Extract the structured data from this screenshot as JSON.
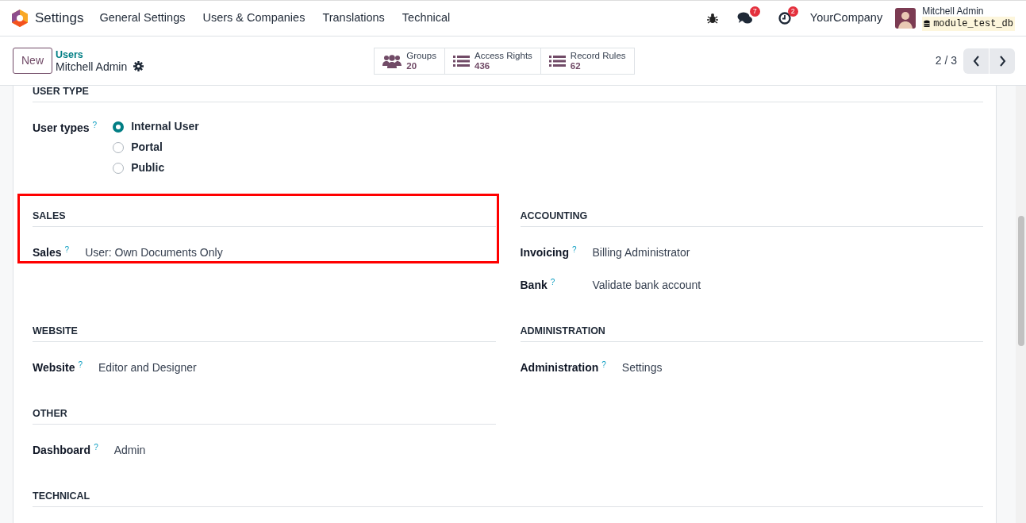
{
  "navbar": {
    "app_name": "Settings",
    "menu": [
      "General Settings",
      "Users & Companies",
      "Translations",
      "Technical"
    ],
    "messages_count": "7",
    "activities_count": "2",
    "company": "YourCompany",
    "user": {
      "name": "Mitchell Admin",
      "database": "module_test_db"
    }
  },
  "control_panel": {
    "new_button": "New",
    "breadcrumb": "Users",
    "record": "Mitchell Admin",
    "stat_buttons": [
      {
        "kind": "groups",
        "label": "Groups",
        "value": "20"
      },
      {
        "kind": "list",
        "label": "Access Rights",
        "value": "436"
      },
      {
        "kind": "list",
        "label": "Record Rules",
        "value": "62"
      }
    ],
    "pager": "2 / 3"
  },
  "sections": [
    {
      "title": "USER TYPE",
      "full_width": true,
      "highlighted": false,
      "fields": [
        {
          "kind": "radio",
          "label": "User types",
          "help": "?",
          "options": [
            {
              "label": "Internal User",
              "selected": true
            },
            {
              "label": "Portal",
              "selected": false
            },
            {
              "label": "Public",
              "selected": false
            }
          ]
        }
      ]
    },
    {
      "title": "SALES",
      "full_width": false,
      "highlighted": true,
      "fields": [
        {
          "kind": "value",
          "label": "Sales",
          "help": "?",
          "value": "User: Own Documents Only"
        }
      ]
    },
    {
      "title": "ACCOUNTING",
      "full_width": false,
      "highlighted": false,
      "fields": [
        {
          "kind": "value",
          "label": "Invoicing",
          "help": "?",
          "value": "Billing Administrator"
        },
        {
          "kind": "value",
          "label": "Bank",
          "help": "?",
          "value": "Validate bank account"
        }
      ]
    },
    {
      "title": "WEBSITE",
      "full_width": false,
      "highlighted": false,
      "fields": [
        {
          "kind": "value",
          "label": "Website",
          "help": "?",
          "value": "Editor and Designer"
        }
      ]
    },
    {
      "title": "ADMINISTRATION",
      "full_width": false,
      "highlighted": false,
      "fields": [
        {
          "kind": "value",
          "label": "Administration",
          "help": "?",
          "value": "Settings"
        }
      ]
    },
    {
      "title": "OTHER",
      "full_width": false,
      "highlighted": false,
      "fields": [
        {
          "kind": "value",
          "label": "Dashboard",
          "help": "?",
          "value": "Admin"
        }
      ]
    },
    {
      "title": "TECHNICAL",
      "full_width": true,
      "highlighted": false
    }
  ]
}
